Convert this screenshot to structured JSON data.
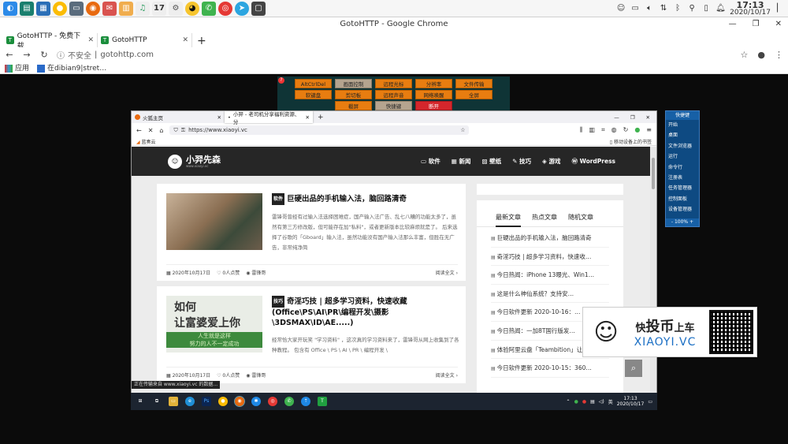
{
  "window": {
    "title": "GotoHTTP - Google Chrome"
  },
  "chrome": {
    "tabs": [
      {
        "label": "GotoHTTP - 免费下载"
      },
      {
        "label": "GotoHTTP"
      }
    ],
    "insecure_label": "不安全",
    "url": "gotohttp.com",
    "bookmarks": [
      {
        "label": "应用"
      },
      {
        "label": "在dibian9|stret…"
      }
    ]
  },
  "os_clock": {
    "time": "17:13",
    "date": "2020/10/17"
  },
  "gotohttp_toolbar": {
    "badge": "?",
    "buttons": [
      "AltCtrlDel",
      "画面控制",
      "远程光标",
      "分辨率",
      "文件传输",
      "软键盘",
      "剪切板",
      "远程声音",
      "网络唤醒",
      "全屏",
      "截屏",
      "快捷键",
      "断开"
    ]
  },
  "shortcut_panel": {
    "title": "快捷键",
    "items": [
      "开始",
      "桌面",
      "文件浏览器",
      "运行",
      "命令行",
      "注册表",
      "任务管理器",
      "控制面板",
      "设备管理器"
    ],
    "zoom": "100%"
  },
  "firefox": {
    "tabs": [
      {
        "label": "火狐主页"
      },
      {
        "label": "小羿 - 老司机分享福利资源、分"
      }
    ],
    "url": "https://www.xiaoyi.vc",
    "bookmark": "蓝奏云",
    "mobile_bookmarks": "移动设备上的书签",
    "status": "正在传输来自 www.xiaoyi.vc 的数据..."
  },
  "site": {
    "logo_name": "小羿先森",
    "logo_sub": "www.xiaoyi.vc",
    "menu": [
      "软件",
      "新闻",
      "壁纸",
      "技巧",
      "游戏",
      "WordPress"
    ],
    "posts": [
      {
        "tag": "软件",
        "title": "巨硬出品的手机输入法，脑回路清奇",
        "excerpt": "雷锋哥曾经有过输入法选择困难症，国产输入法广告、乱七八糟的功能太多了，虽然有第三方修改版，但可能存在加\"私料\"，或者更新版本比较麻烦就是了。 后来选择了谷歌的「Gboard」输入法，虽然功能没有国产输入法那么丰富，但胜在无广告，非常纯净简",
        "date": "2020年10月17日",
        "likes": "0人点赞",
        "author": "雷锋哥",
        "more": "阅读全文"
      },
      {
        "tag": "技巧",
        "title": "奇淫巧技 | 超多学习资料，快速收藏(Office\\PS\\AI\\PR\\编程开发\\摄影\\3DSMAX\\ID\\AE.....)",
        "excerpt": "经常恰大家开玩笑 \"学习资料\" ，这次真的学习资料来了，雷锋哥从网上收集到了各种教程。 包含有 Office \\ PS \\ AI \\ PR \\ 编程开发 \\",
        "thumb_line1": "如何",
        "thumb_line2": "让富婆爱上你",
        "thumb_line3": "人生就是这样",
        "thumb_line4": "努力的人不一定成功",
        "date": "2020年10月17日",
        "likes": "0人点赞",
        "author": "雷锋哥",
        "more": "阅读全文"
      }
    ],
    "sidebar_tabs": [
      "最新文章",
      "热点文章",
      "随机文章"
    ],
    "sidebar_items": [
      "巨硬出品的手机输入法，脑回路清奇",
      "奇淫巧技 | 超多学习资料，快速收…",
      "今日热闻：iPhone 13曝光、Win1…",
      "这是什么神仙系统？支持安…",
      "今日软件更新 2020-10-16：…",
      "今日热闻：一加8T国行版发…",
      "体验阿里云盘「Teambition」让…",
      "今日软件更新 2020-10-15：360…"
    ]
  },
  "taskbar": {
    "time": "17:13",
    "date": "2020/10/17",
    "ime": "英"
  },
  "ad": {
    "cn_pre": "快",
    "cn_mid": "投币",
    "cn_post": "上车",
    "en": "XIAOYI.VC"
  }
}
